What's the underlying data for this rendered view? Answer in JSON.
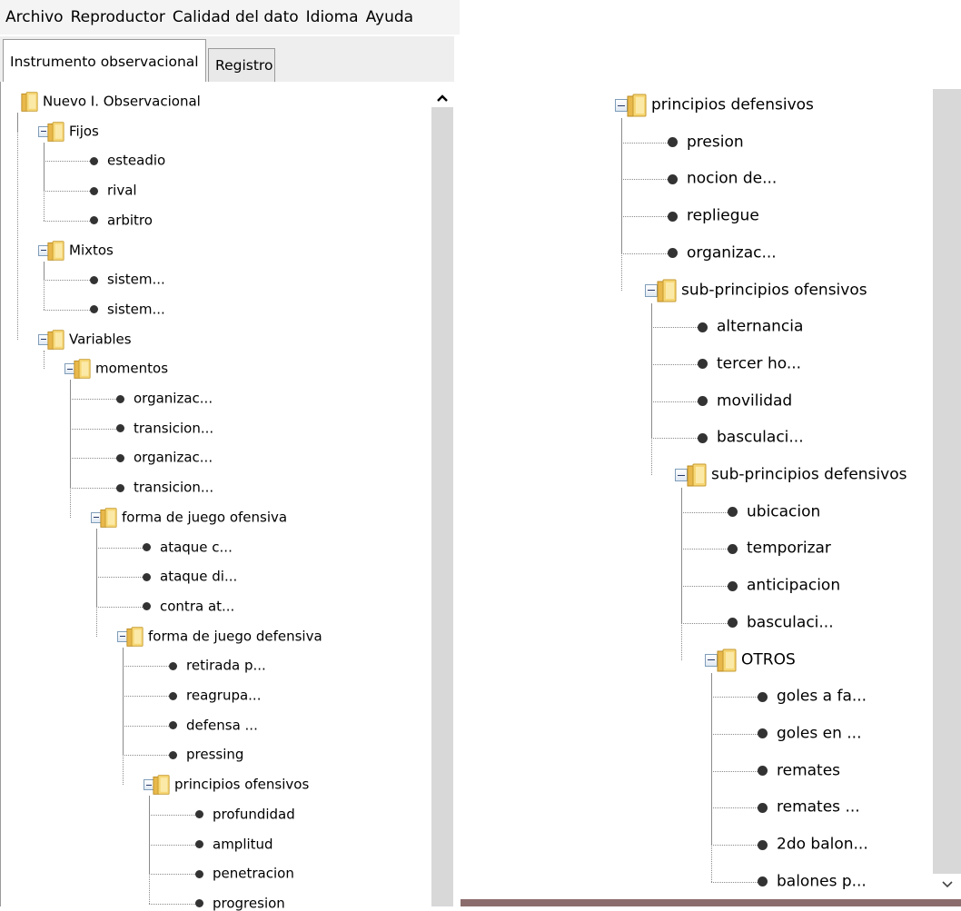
{
  "menu": [
    "Archivo",
    "Reproductor",
    "Calidad del dato",
    "Idioma",
    "Ayuda"
  ],
  "tabs": [
    {
      "label": "Instrumento observacional",
      "active": true
    },
    {
      "label": "Registro",
      "active": false
    }
  ],
  "scroll": {
    "up_icon": "chevron-up-icon",
    "down_icon": "chevron-down-icon"
  },
  "left_tree": [
    {
      "label": "Nuevo I. Observacional",
      "level": 0,
      "type": "folder",
      "expander": false,
      "last": true
    },
    {
      "label": "Fijos",
      "level": 1,
      "type": "folder",
      "expander": true,
      "last": false
    },
    {
      "label": "esteadio",
      "level": 2,
      "type": "leaf",
      "last": false
    },
    {
      "label": "rival",
      "level": 2,
      "type": "leaf",
      "last": false
    },
    {
      "label": "arbitro",
      "level": 2,
      "type": "leaf",
      "last": true
    },
    {
      "label": "Mixtos",
      "level": 1,
      "type": "folder",
      "expander": true,
      "last": false
    },
    {
      "label": "sistem...",
      "level": 2,
      "type": "leaf",
      "last": false
    },
    {
      "label": "sistem...",
      "level": 2,
      "type": "leaf",
      "last": true
    },
    {
      "label": "Variables",
      "level": 1,
      "type": "folder",
      "expander": true,
      "last": true
    },
    {
      "label": "momentos",
      "level": 2,
      "type": "folder",
      "expander": true,
      "last": true
    },
    {
      "label": "organizac...",
      "level": 3,
      "type": "leaf",
      "last": false
    },
    {
      "label": "transicion...",
      "level": 3,
      "type": "leaf",
      "last": false
    },
    {
      "label": "organizac...",
      "level": 3,
      "type": "leaf",
      "last": false
    },
    {
      "label": "transicion...",
      "level": 3,
      "type": "leaf",
      "last": false
    },
    {
      "label": "forma de juego ofensiva",
      "level": 3,
      "type": "folder",
      "expander": true,
      "last": true
    },
    {
      "label": "ataque c...",
      "level": 4,
      "type": "leaf",
      "last": false
    },
    {
      "label": "ataque di...",
      "level": 4,
      "type": "leaf",
      "last": false
    },
    {
      "label": "contra at...",
      "level": 4,
      "type": "leaf",
      "last": false
    },
    {
      "label": "forma de juego defensiva",
      "level": 4,
      "type": "folder",
      "expander": true,
      "last": true
    },
    {
      "label": "retirada p...",
      "level": 5,
      "type": "leaf",
      "last": false
    },
    {
      "label": "reagrupa...",
      "level": 5,
      "type": "leaf",
      "last": false
    },
    {
      "label": "defensa ...",
      "level": 5,
      "type": "leaf",
      "last": false
    },
    {
      "label": "pressing",
      "level": 5,
      "type": "leaf",
      "last": false
    },
    {
      "label": "principios ofensivos",
      "level": 5,
      "type": "folder",
      "expander": true,
      "last": true
    },
    {
      "label": "profundidad",
      "level": 6,
      "type": "leaf",
      "last": false
    },
    {
      "label": "amplitud",
      "level": 6,
      "type": "leaf",
      "last": false
    },
    {
      "label": "penetracion",
      "level": 6,
      "type": "leaf",
      "last": false
    },
    {
      "label": "progresion",
      "level": 6,
      "type": "leaf",
      "last": false
    }
  ],
  "right_tree": [
    {
      "label": "principios defensivos",
      "level": 0,
      "type": "folder",
      "expander": true,
      "last": true
    },
    {
      "label": "presion",
      "level": 1,
      "type": "leaf",
      "last": false
    },
    {
      "label": "nocion de...",
      "level": 1,
      "type": "leaf",
      "last": false
    },
    {
      "label": "repliegue",
      "level": 1,
      "type": "leaf",
      "last": false
    },
    {
      "label": "organizac...",
      "level": 1,
      "type": "leaf",
      "last": false
    },
    {
      "label": "sub-principios ofensivos",
      "level": 1,
      "type": "folder",
      "expander": true,
      "last": true
    },
    {
      "label": "alternancia",
      "level": 2,
      "type": "leaf",
      "last": false
    },
    {
      "label": "tercer ho...",
      "level": 2,
      "type": "leaf",
      "last": false
    },
    {
      "label": "movilidad",
      "level": 2,
      "type": "leaf",
      "last": false
    },
    {
      "label": "basculaci...",
      "level": 2,
      "type": "leaf",
      "last": false
    },
    {
      "label": "sub-principios defensivos",
      "level": 2,
      "type": "folder",
      "expander": true,
      "last": true
    },
    {
      "label": "ubicacion",
      "level": 3,
      "type": "leaf",
      "last": false
    },
    {
      "label": "temporizar",
      "level": 3,
      "type": "leaf",
      "last": false
    },
    {
      "label": "anticipacion",
      "level": 3,
      "type": "leaf",
      "last": false
    },
    {
      "label": "basculaci...",
      "level": 3,
      "type": "leaf",
      "last": false
    },
    {
      "label": "OTROS",
      "level": 3,
      "type": "folder",
      "expander": true,
      "last": true
    },
    {
      "label": "goles a fa...",
      "level": 4,
      "type": "leaf",
      "last": false
    },
    {
      "label": "goles en ...",
      "level": 4,
      "type": "leaf",
      "last": false
    },
    {
      "label": "remates",
      "level": 4,
      "type": "leaf",
      "last": false
    },
    {
      "label": "remates ...",
      "level": 4,
      "type": "leaf",
      "last": false
    },
    {
      "label": "2do balon...",
      "level": 4,
      "type": "leaf",
      "last": false
    },
    {
      "label": "balones p...",
      "level": 4,
      "type": "leaf",
      "last": true
    }
  ]
}
